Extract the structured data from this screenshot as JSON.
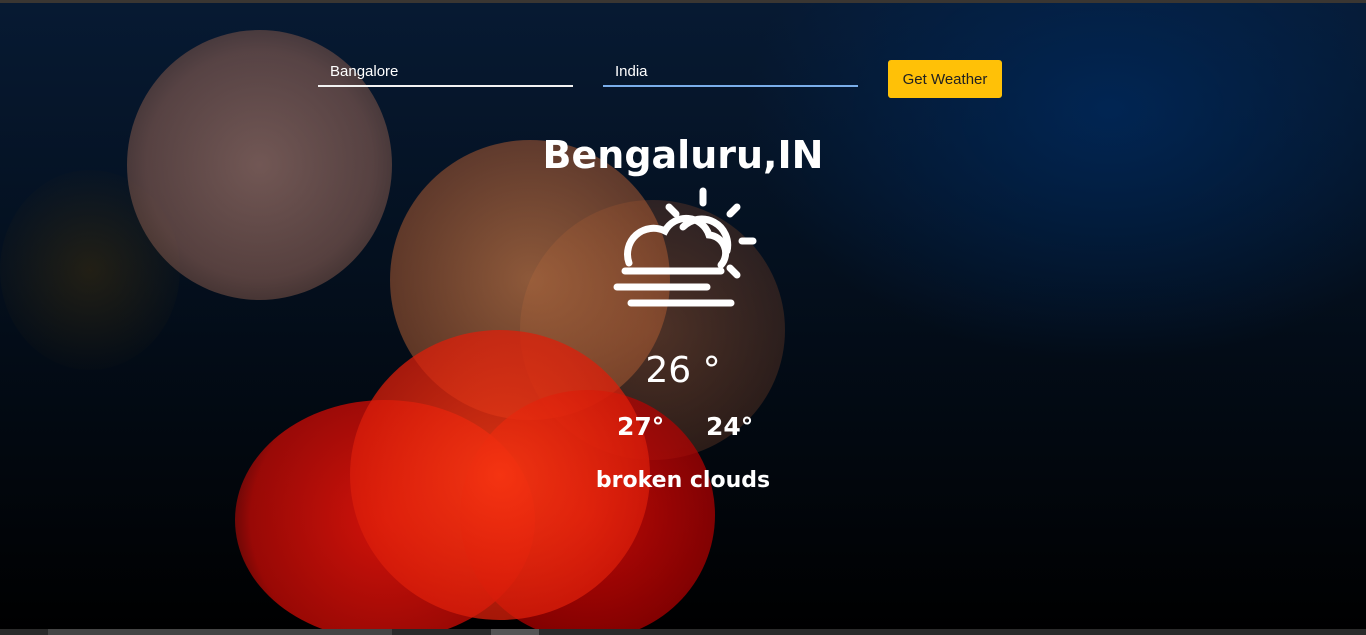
{
  "form": {
    "city_value": "Bangalore",
    "country_value": "India",
    "button_label": "Get Weather"
  },
  "weather": {
    "location": "Bengaluru,IN",
    "icon": "cloudy-sun-icon",
    "temperature": "26 °",
    "max_temp": "27°",
    "min_temp": "24°",
    "description": "broken clouds"
  },
  "colors": {
    "button": "#ffc107",
    "focused_input_underline": "#7aaeea",
    "text": "#ffffff"
  }
}
